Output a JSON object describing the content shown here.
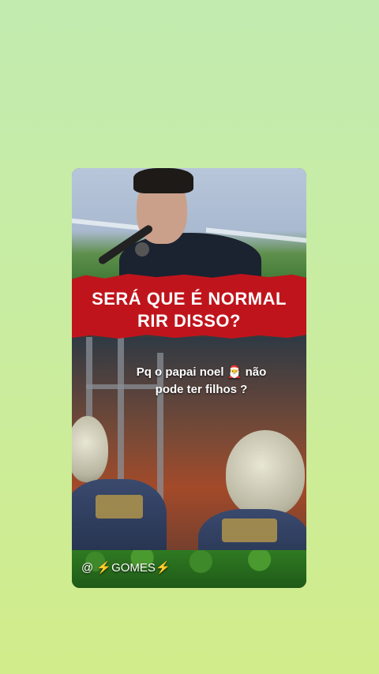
{
  "video": {
    "title_line1": "SERÁ QUE É NORMAL",
    "title_line2": "RIR DISSO?",
    "caption_part1": "Pq o papai noel",
    "caption_emoji": "🎅",
    "caption_part2": "não pode ter filhos ?",
    "watermark_prefix": "@",
    "watermark_bolt": "⚡",
    "watermark_name": "GOMES"
  },
  "colors": {
    "banner": "#c0141c",
    "background_top": "#c2ebb0",
    "background_bottom": "#d1ec8a"
  }
}
